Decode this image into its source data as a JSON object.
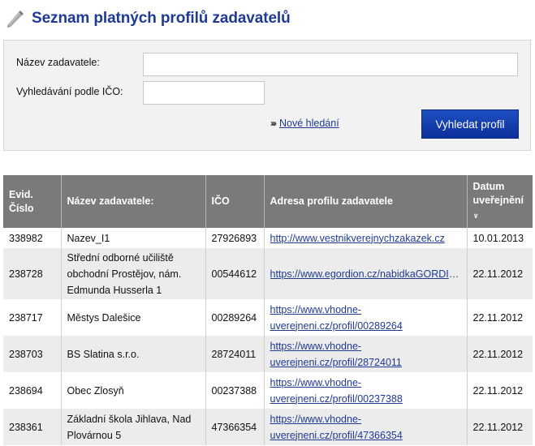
{
  "page": {
    "title": "Seznam platných profilů zadavatelů"
  },
  "search": {
    "name_label": "Název zadavatele:",
    "name_value": "",
    "ico_label": "Vyhledávání podle IČO:",
    "ico_value": "",
    "new_search_label": "Nové hledání",
    "submit_label": "Vyhledat profil"
  },
  "table": {
    "headers": {
      "evid": "Evid. Číslo",
      "name": "Název zadavatele:",
      "ico": "IČO",
      "url": "Adresa profilu zadavatele",
      "date": "Datum uveřejnění"
    },
    "rows": [
      {
        "evid": "338982",
        "name": "Nazev_I1",
        "ico": "27926893",
        "url": "http://www.vestnikverejnychzakazek.cz",
        "date": "10.01.2013"
      },
      {
        "evid": "238728",
        "name": "Střední odborné učiliště obchodní Prostějov, nám. Edmunda Husserla 1",
        "ico": "00544612",
        "url": "https://www.egordion.cz/nabidkaGORDIO…",
        "date": "22.11.2012"
      },
      {
        "evid": "238717",
        "name": "Městys Dalešice",
        "ico": "00289264",
        "url": "https://www.vhodne-uverejneni.cz/profil/00289264",
        "date": "22.11.2012"
      },
      {
        "evid": "238703",
        "name": "BS Slatina s.r.o.",
        "ico": "28724011",
        "url": "https://www.vhodne-uverejneni.cz/profil/28724011",
        "date": "22.11.2012"
      },
      {
        "evid": "238694",
        "name": "Obec Zlosyň",
        "ico": "00237388",
        "url": "https://www.vhodne-uverejneni.cz/profil/00237388",
        "date": "22.11.2012"
      },
      {
        "evid": "238361",
        "name": "Základní škola Jihlava, Nad Plovárnou 5",
        "ico": "47366354",
        "url": "https://www.vhodne-uverejneni.cz/profil/47366354",
        "date": "22.11.2012"
      }
    ]
  },
  "colors": {
    "title": "#1f3a93",
    "header_bg": "#7a7a7a",
    "button_bg": "#1641b0",
    "row_alt": "#ececec"
  }
}
